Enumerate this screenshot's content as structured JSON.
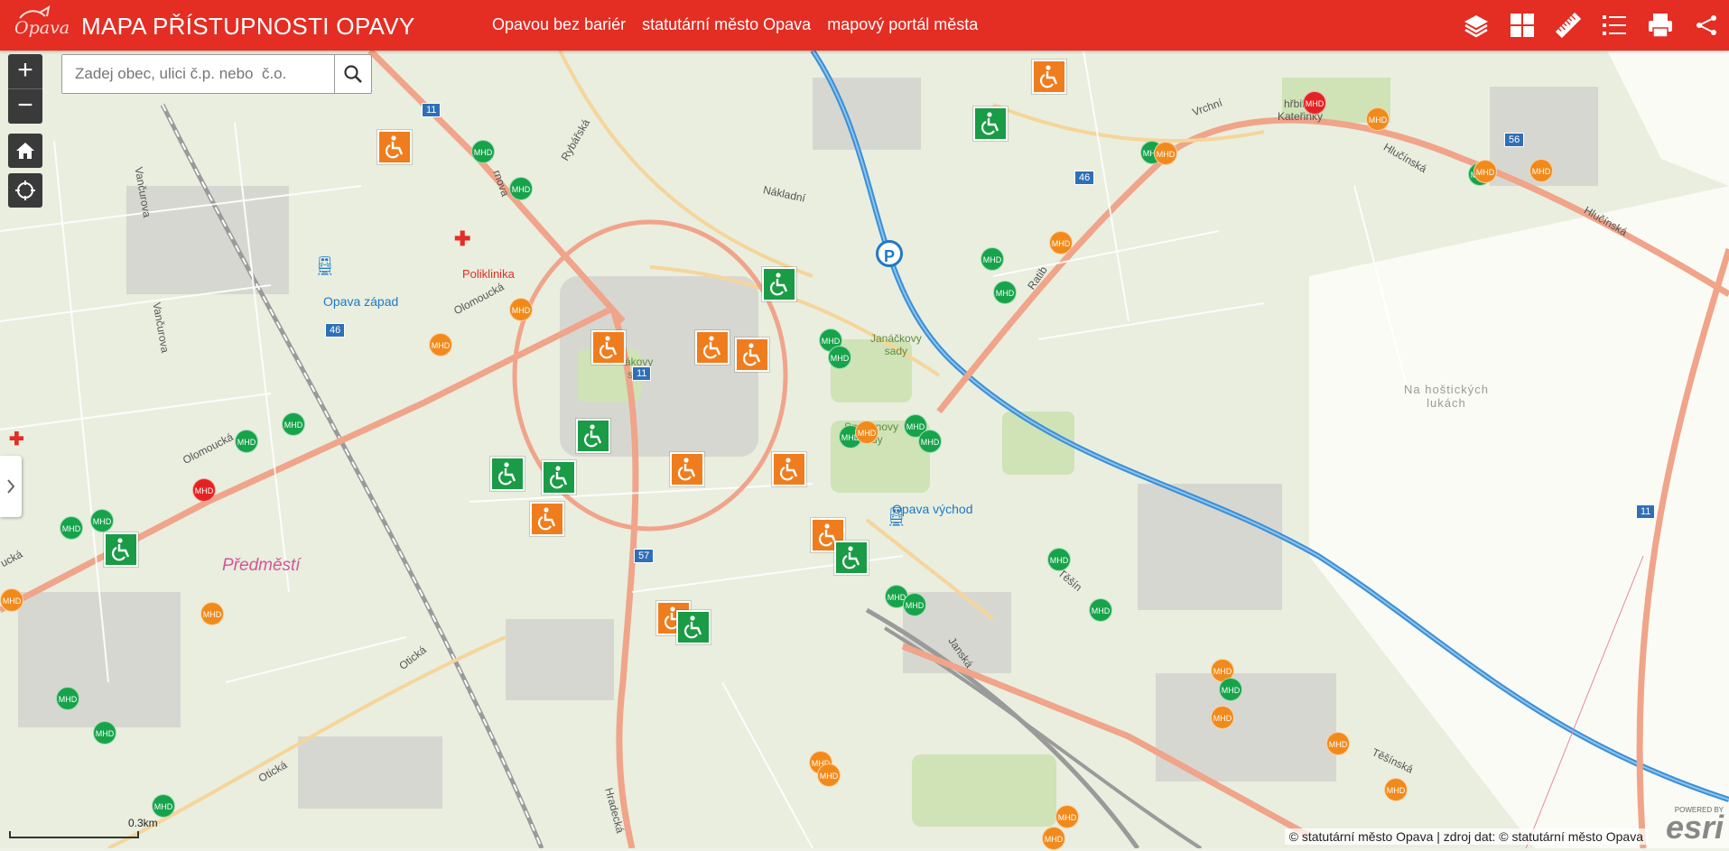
{
  "header": {
    "logo_text": "Opava",
    "title": "MAPA PŘÍSTUPNOSTI OPAVY",
    "nav": [
      "Opavou bez bariér",
      "statutární město Opava",
      "mapový portál města"
    ],
    "tools": [
      "layers-icon",
      "basemap-gallery-icon",
      "measure-icon",
      "legend-icon",
      "print-icon",
      "share-icon"
    ]
  },
  "search": {
    "placeholder": "Zadej obec, ulici č.p. nebo  č.o."
  },
  "controls": {
    "zoom_in": "+",
    "zoom_out": "−"
  },
  "map_labels": {
    "poliklinika": "Poliklinika",
    "opava_zapad": "Opava západ",
    "opava_vychod": "Opava východ",
    "predmesti": "Předměstí",
    "hrbitov": "hřbitov\nKateřinky",
    "na_hosticke": "Na hoštických\nlukách",
    "janackovy_sady": "Janáčkovy\nsady",
    "smetanovy_sady": "Smetanovy\nsady",
    "ptakovy_sady": "ákovy\nsady"
  },
  "streets": {
    "nakladni": "Nákladní",
    "olomoucka1": "Olomoucká",
    "olomoucka2": "Olomoucká",
    "olomoucka3": "ucká",
    "hlucinska1": "Hlučínská",
    "hlucinska2": "Hlučínská",
    "vancurova1": "Vančurova",
    "vancurova2": "Vančurova",
    "janska": "Janská",
    "tesinska": "Těšínská",
    "tesinska2": "Těšín",
    "ratibor": "Ratib",
    "vrchni": "Vrchní",
    "rybarska": "Rybářská",
    "oticka1": "Otická",
    "oticka2": "Otická",
    "hradecka": "Hradecká",
    "krnovska": "rnova"
  },
  "road_shields": [
    "11",
    "46",
    "46",
    "11",
    "57",
    "56",
    "11"
  ],
  "marker_label": "MHD",
  "scale": "0.3km",
  "attribution": "© statutární město Opava | zdroj dat: © statutární město Opava",
  "esri": {
    "powered": "POWERED BY",
    "name": "esri"
  },
  "colors": {
    "header": "#e42d23",
    "mhd_green": "#17a34a",
    "mhd_orange": "#f28a1b",
    "mhd_red": "#e52222",
    "wheelchair_green": "#1a9b45",
    "wheelchair_orange": "#ef7d1e",
    "river": "#3b8fd6"
  }
}
